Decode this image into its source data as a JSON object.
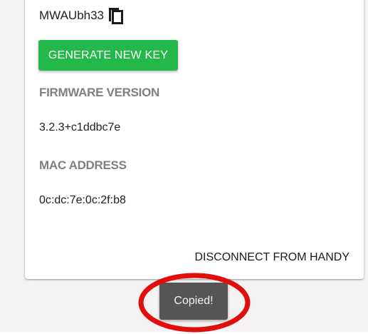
{
  "device": {
    "key": "MWAUbh33",
    "copy_icon": "copy-icon",
    "generate_button_label": "GENERATE NEW KEY"
  },
  "firmware": {
    "label": "FIRMWARE VERSION",
    "value": "3.2.3+c1ddbc7e"
  },
  "mac": {
    "label": "MAC ADDRESS",
    "value": "0c:dc:7e:0c:2f:b8"
  },
  "actions": {
    "disconnect_label": "DISCONNECT FROM HANDY"
  },
  "toast": {
    "message": "Copied!"
  },
  "colors": {
    "accent_green": "#23b84a",
    "annotation_red": "#e10e0e",
    "toast_bg": "#555555",
    "label_gray": "#7f7f7f"
  }
}
